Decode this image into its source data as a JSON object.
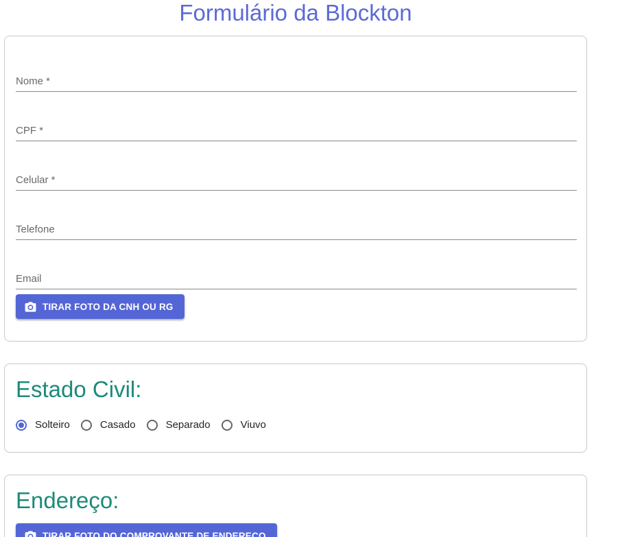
{
  "header": {
    "title": "Formulário da Blockton"
  },
  "personal": {
    "fields": [
      {
        "label": "Nome *",
        "value": ""
      },
      {
        "label": "CPF *",
        "value": ""
      },
      {
        "label": "Celular *",
        "value": ""
      },
      {
        "label": "Telefone",
        "value": ""
      },
      {
        "label": "Email",
        "value": ""
      }
    ],
    "photo_button": {
      "label": "TIRAR FOTO DA CNH OU RG",
      "icon": "camera-icon"
    }
  },
  "civil": {
    "title": "Estado Civil:",
    "options": [
      {
        "label": "Solteiro",
        "checked": true
      },
      {
        "label": "Casado",
        "checked": false
      },
      {
        "label": "Separado",
        "checked": false
      },
      {
        "label": "Viuvo",
        "checked": false
      }
    ]
  },
  "address": {
    "title": "Endereço:",
    "photo_button": {
      "label": "TIRAR FOTO DO COMPROVANTE DE ENDEREÇO",
      "icon": "camera-icon"
    }
  },
  "colors": {
    "primary": "#5466d6",
    "title": "#5b6ad6",
    "section_title": "#1c8a7a"
  }
}
